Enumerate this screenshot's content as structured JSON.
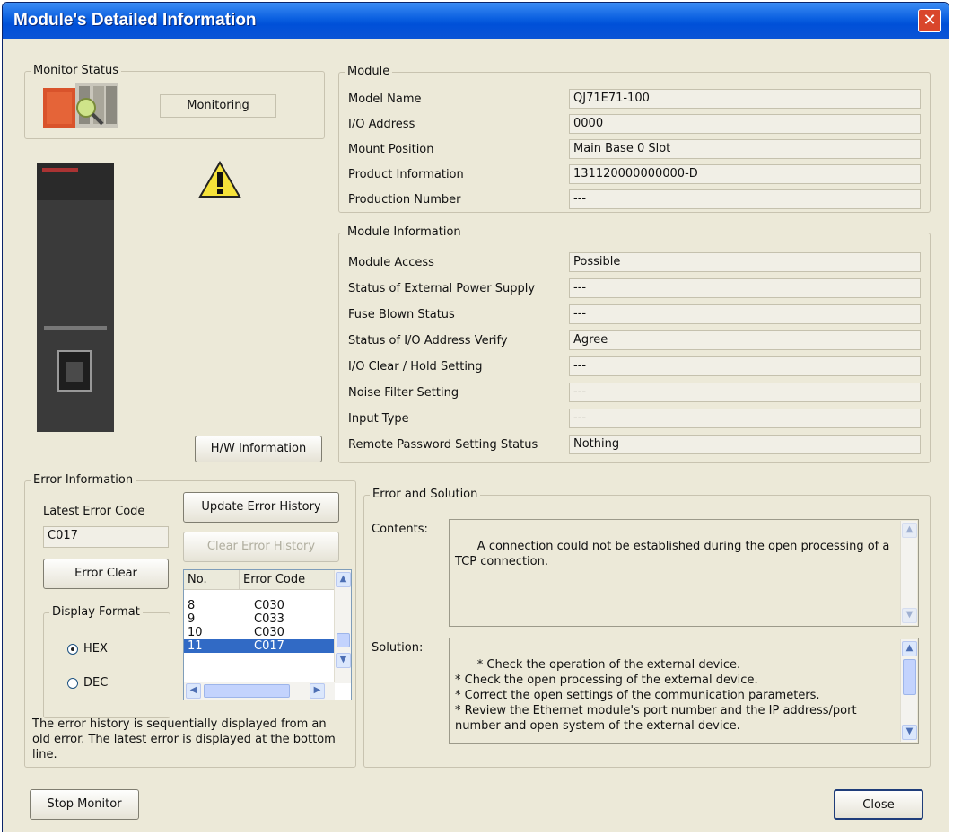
{
  "window": {
    "title": "Module's Detailed Information",
    "close_glyph": "✕"
  },
  "monitor_status": {
    "legend": "Monitor Status",
    "status_text": "Monitoring"
  },
  "module": {
    "legend": "Module",
    "rows": [
      {
        "label": "Model Name",
        "value": "QJ71E71-100"
      },
      {
        "label": "I/O Address",
        "value": "0000"
      },
      {
        "label": "Mount Position",
        "value": "Main Base  0 Slot"
      },
      {
        "label": "Product Information",
        "value": "131120000000000-D"
      },
      {
        "label": "Production Number",
        "value": "---"
      }
    ]
  },
  "module_information": {
    "legend": "Module Information",
    "rows": [
      {
        "label": "Module Access",
        "value": "Possible"
      },
      {
        "label": "Status of External Power Supply",
        "value": "---"
      },
      {
        "label": "Fuse Blown Status",
        "value": "---"
      },
      {
        "label": "Status of I/O Address Verify",
        "value": "Agree"
      },
      {
        "label": "I/O Clear / Hold Setting",
        "value": "---"
      },
      {
        "label": "Noise Filter Setting",
        "value": "---"
      },
      {
        "label": "Input Type",
        "value": "---"
      },
      {
        "label": "Remote Password Setting Status",
        "value": "Nothing"
      }
    ]
  },
  "hw_button": "H/W Information",
  "error_information": {
    "legend": "Error Information",
    "latest_label": "Latest Error Code",
    "latest_value": "C017",
    "update_button": "Update Error History",
    "clear_history_button": "Clear Error History",
    "error_clear_button": "Error Clear",
    "display_format": {
      "legend": "Display Format",
      "hex": "HEX",
      "dec": "DEC",
      "selected": "HEX"
    },
    "history": {
      "col_no": "No.",
      "col_code": "Error Code",
      "rows": [
        {
          "no": "8",
          "code": "C030"
        },
        {
          "no": "9",
          "code": "C033"
        },
        {
          "no": "10",
          "code": "C030"
        },
        {
          "no": "11",
          "code": "C017"
        }
      ],
      "selected_no": "11"
    },
    "note": "The error history is sequentially displayed from an old error. The latest error is displayed at the bottom line."
  },
  "error_solution": {
    "legend": "Error and Solution",
    "contents_label": "Contents:",
    "contents": "A connection could not be established during the open processing of a TCP connection.",
    "solution_label": "Solution:",
    "solution": "* Check the operation of the external device.\n* Check the open processing of the external device.\n* Correct the open settings of the communication parameters.\n* Review the Ethernet module's port number and the IP address/port number and open system of the external device."
  },
  "footer": {
    "stop_button": "Stop Monitor",
    "close_button": "Close"
  },
  "icons": {
    "warning": "warning-icon",
    "module_image": "module-image",
    "monitor_image": "monitor-status-image"
  },
  "colors": {
    "title_bar": "#0a5fe0",
    "close_button": "#d9462b",
    "selected_row": "#316ac5",
    "dialog_bg": "#ece9d8"
  }
}
